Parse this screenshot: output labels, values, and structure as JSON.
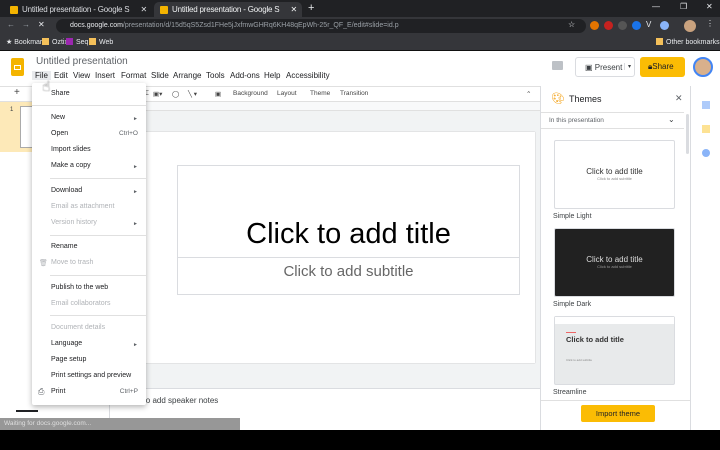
{
  "browser": {
    "tabs": [
      {
        "title": "Untitled presentation - Google S",
        "active": false
      },
      {
        "title": "Untitled presentation - Google S",
        "active": true
      }
    ],
    "new_tab": "+",
    "url_host": "docs.google.com",
    "url_path": "/presentation/d/15d5qS5Zsd1FHe5jJxfmwGHRq6KH48qEpWh-25r_QF_E/edit#slide=id.p",
    "bookmarks": [
      "Bookmarks",
      "Oztix",
      "Seq",
      "Web"
    ],
    "other_bookmarks": "Other bookmarks"
  },
  "app": {
    "doc_title": "Untitled presentation",
    "menu": [
      "File",
      "Edit",
      "View",
      "Insert",
      "Format",
      "Slide",
      "Arrange",
      "Tools",
      "Add-ons",
      "Help",
      "Accessibility"
    ],
    "present_label": "Present",
    "share_label": "Share",
    "accent": "#fbbc04"
  },
  "toolbar": {
    "background": "Background",
    "layout": "Layout",
    "theme": "Theme",
    "transition": "Transition"
  },
  "file_menu": {
    "items": [
      {
        "label": "Share"
      },
      {
        "label": "New",
        "submenu": true
      },
      {
        "label": "Open",
        "shortcut": "Ctrl+O"
      },
      {
        "label": "Import slides"
      },
      {
        "label": "Make a copy",
        "submenu": true
      },
      {
        "label": "Download",
        "submenu": true
      },
      {
        "label": "Email as attachment",
        "disabled": true
      },
      {
        "label": "Version history",
        "submenu": true,
        "disabled": true
      },
      {
        "label": "Rename"
      },
      {
        "label": "Move to trash",
        "disabled": true
      },
      {
        "label": "Publish to the web"
      },
      {
        "label": "Email collaborators",
        "disabled": true
      },
      {
        "label": "Document details",
        "disabled": true
      },
      {
        "label": "Language",
        "submenu": true
      },
      {
        "label": "Page setup"
      },
      {
        "label": "Print settings and preview"
      },
      {
        "label": "Print",
        "shortcut": "Ctrl+P"
      }
    ]
  },
  "filmstrip": {
    "slide_number": "1"
  },
  "slide": {
    "title_placeholder": "Click to add title",
    "subtitle_placeholder": "Click to add subtitle"
  },
  "notes_placeholder": "Click to add speaker notes",
  "themes": {
    "title": "Themes",
    "filter": "In this presentation",
    "items": [
      {
        "name": "Simple Light",
        "title": "Click to add title",
        "subtitle": "Click to add subtitle"
      },
      {
        "name": "Simple Dark",
        "title": "Click to add title",
        "subtitle": "Click to add subtitle"
      },
      {
        "name": "Streamline",
        "title": "Click to add title",
        "subtitle": "Click to add subtitle"
      }
    ],
    "import_label": "Import theme"
  },
  "status_text": "Waiting for docs.google.com..."
}
